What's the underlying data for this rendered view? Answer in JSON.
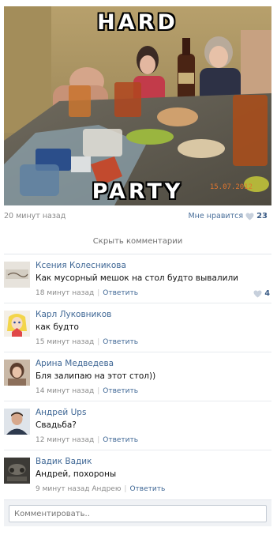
{
  "photo": {
    "caption_top": "HARD",
    "caption_bottom": "PARTY",
    "date_stamp": "15.07.2012"
  },
  "post": {
    "time": "20 минут назад",
    "like_label": "Мне нравится",
    "like_count": "23",
    "like_icon": "heart-icon"
  },
  "comments_toggle": "Скрыть комментарии",
  "comments": [
    {
      "author": "Ксения Колесникова",
      "text": "Как мусорный мешок на стол будто вывалили",
      "time": "18 минут назад",
      "reply": "Ответить",
      "likes": "4"
    },
    {
      "author": "Карл Луковников",
      "text": "как будто",
      "time": "15 минут назад",
      "reply": "Ответить"
    },
    {
      "author": "Арина Медведева",
      "text": "Бля залипаю на этот стол))",
      "time": "14 минут назад",
      "reply": "Ответить"
    },
    {
      "author": "Андрей Ups",
      "text": "Свадьба?",
      "time": "12 минут назад",
      "reply": "Ответить"
    },
    {
      "author": "Вадик Вадик",
      "text": "Андрей, похороны",
      "time": "9 минут назад Андрею",
      "reply": "Ответить"
    }
  ],
  "composer": {
    "placeholder": "Комментировать.."
  },
  "colors": {
    "link": "#3f6795",
    "meta": "#8a8a8a",
    "date_stamp": "#e0762f"
  }
}
